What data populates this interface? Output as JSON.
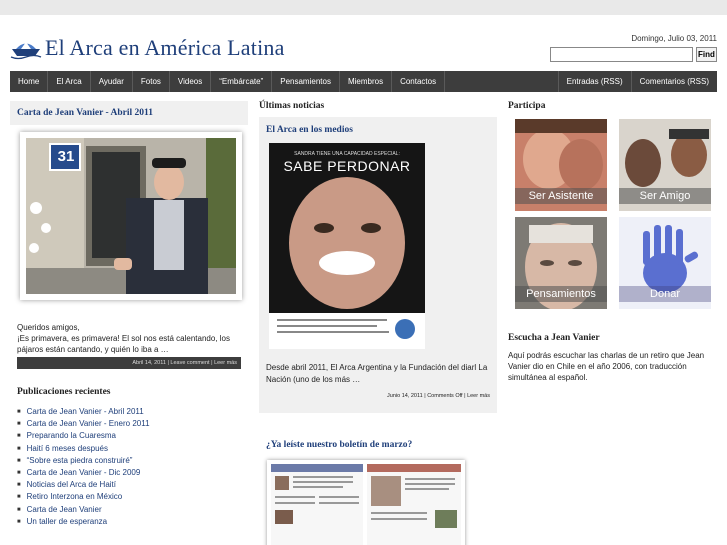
{
  "header": {
    "site_title": "El Arca en América Latina",
    "date": "Domingo, Julio 03, 2011",
    "search": {
      "value": "",
      "button_label": "Find"
    }
  },
  "nav": {
    "items": [
      "Home",
      "El Arca",
      "Ayudar",
      "Fotos",
      "Videos",
      "“Embárcate”",
      "Pensamientos",
      "Miembros",
      "Contactos"
    ],
    "right_items": [
      "Entradas (RSS)",
      "Comentarios (RSS)"
    ]
  },
  "left": {
    "post_title": "Carta de Jean Vanier - Abril 2011",
    "photo_sign": "31",
    "intro_line1": "Queridos amigos,",
    "intro_line2": "¡Es primavera, es primavera! El sol nos está calentando, los pájaros están cantando, y quién lo iba a …",
    "meta_date": "Abril 14, 2011",
    "meta_comment": "Leave comment",
    "meta_more": "Leer más",
    "recent_title": "Publicaciones recientes",
    "recent": [
      "Carta de Jean Vanier - Abril 2011",
      "Carta de Jean Vanier - Enero 2011",
      "Preparando la Cuaresma",
      "Haití 6 meses después",
      "“Sobre esta piedra construiré”",
      "Carta de Jean Vanier - Dic 2009",
      "Noticias del Arca de Haití",
      "Retiro Interzona en México",
      "Carta de Jean Vanier",
      "Un taller de esperanza"
    ]
  },
  "middle": {
    "heading": "Últimas noticias",
    "post_title": "El Arca en los medios",
    "poster_top": "SANDRA TIENE UNA CAPACIDAD ESPECIAL:",
    "poster_headline": "SABE PERDONAR",
    "text": "Desde abril 2011, El Arca Argentina y la Fundación del diarl La Nación (uno de los más …",
    "meta_date": "Junio 14, 2011",
    "meta_comment": "Comments Off",
    "meta_more": "Leer más",
    "boletin_title": "¿Ya leíste nuestro boletín de marzo?"
  },
  "right": {
    "participa_title": "Participa",
    "tiles": [
      "Ser Asistente",
      "Ser Amigo",
      "Pensamientos",
      "Donar"
    ],
    "escucha_title": "Escucha a Jean Vanier",
    "escucha_text": "Aquí podrás escuchar las charlas de un retiro que Jean Vanier dio en Chile en el año 2006, con traducción simultánea al español."
  },
  "colors": {
    "title_blue": "#1f3f7a",
    "nav_bg": "#3d3d3d",
    "box_bg": "#f0f0f0"
  }
}
